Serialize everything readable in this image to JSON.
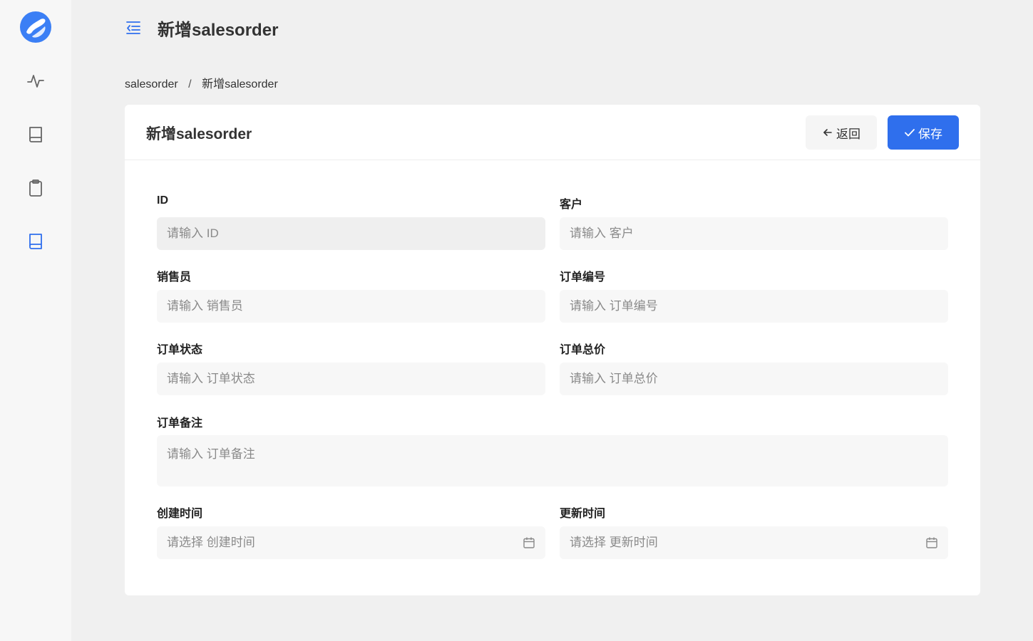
{
  "page": {
    "title": "新增salesorder"
  },
  "breadcrumb": {
    "items": [
      "salesorder",
      "新增salesorder"
    ],
    "separator": "/"
  },
  "card": {
    "title": "新增salesorder",
    "back_label": "返回",
    "save_label": "保存"
  },
  "form": {
    "id": {
      "label": "ID",
      "placeholder": "请输入 ID"
    },
    "customer": {
      "label": "客户",
      "placeholder": "请输入 客户"
    },
    "salesperson": {
      "label": "销售员",
      "placeholder": "请输入 销售员"
    },
    "order_no": {
      "label": "订单编号",
      "placeholder": "请输入 订单编号"
    },
    "order_status": {
      "label": "订单状态",
      "placeholder": "请输入 订单状态"
    },
    "order_total": {
      "label": "订单总价",
      "placeholder": "请输入 订单总价"
    },
    "order_note": {
      "label": "订单备注",
      "placeholder": "请输入 订单备注"
    },
    "created_at": {
      "label": "创建时间",
      "placeholder": "请选择 创建时间"
    },
    "updated_at": {
      "label": "更新时间",
      "placeholder": "请选择 更新时间"
    }
  },
  "icons": {
    "logo": "app-logo",
    "nav": [
      "activity-icon",
      "book-icon",
      "clipboard-icon",
      "book-icon"
    ],
    "menu_toggle": "menu-fold-icon",
    "back": "arrow-left-icon",
    "save": "check-icon",
    "calendar": "calendar-icon"
  },
  "colors": {
    "primary": "#2f6fed",
    "sidebar_bg": "#f7f7f7",
    "page_bg": "#f0f0f0",
    "nav_active": "#2f6fed"
  }
}
